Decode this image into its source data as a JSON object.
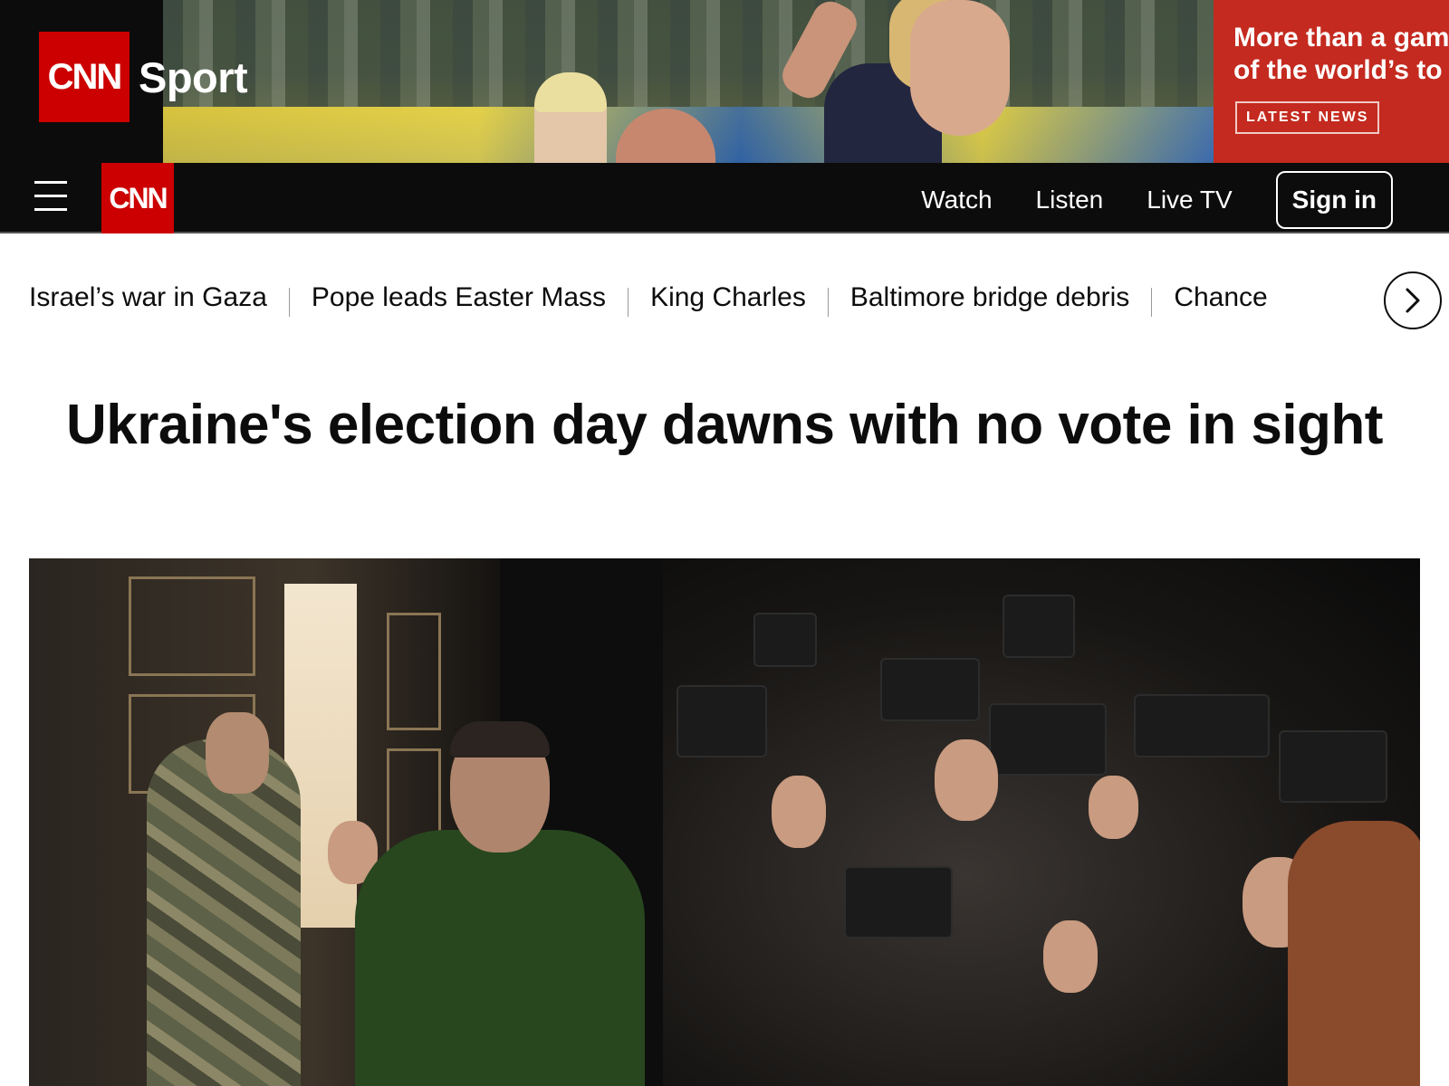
{
  "ad_banner": {
    "logo_text": "CNN",
    "sport_label": "Sport",
    "headline": "More than a game of the world’s to",
    "cta": "LATEST NEWS"
  },
  "navbar": {
    "logo_text": "CNN",
    "links": [
      "Watch",
      "Listen",
      "Live TV"
    ],
    "sign_in": "Sign in"
  },
  "trending": {
    "items": [
      "Israel’s war in Gaza",
      "Pope leads Easter Mass",
      "King Charles",
      "Baltimore bridge debris",
      "Chance"
    ]
  },
  "article": {
    "headline": "Ukraine's election day dawns with no vote in sight"
  },
  "colors": {
    "brand_red": "#cc0000",
    "nav_bg": "#0c0c0c",
    "ad_red": "#c42a1f"
  },
  "icons": {
    "menu": "hamburger-icon",
    "next": "chevron-right-icon"
  }
}
